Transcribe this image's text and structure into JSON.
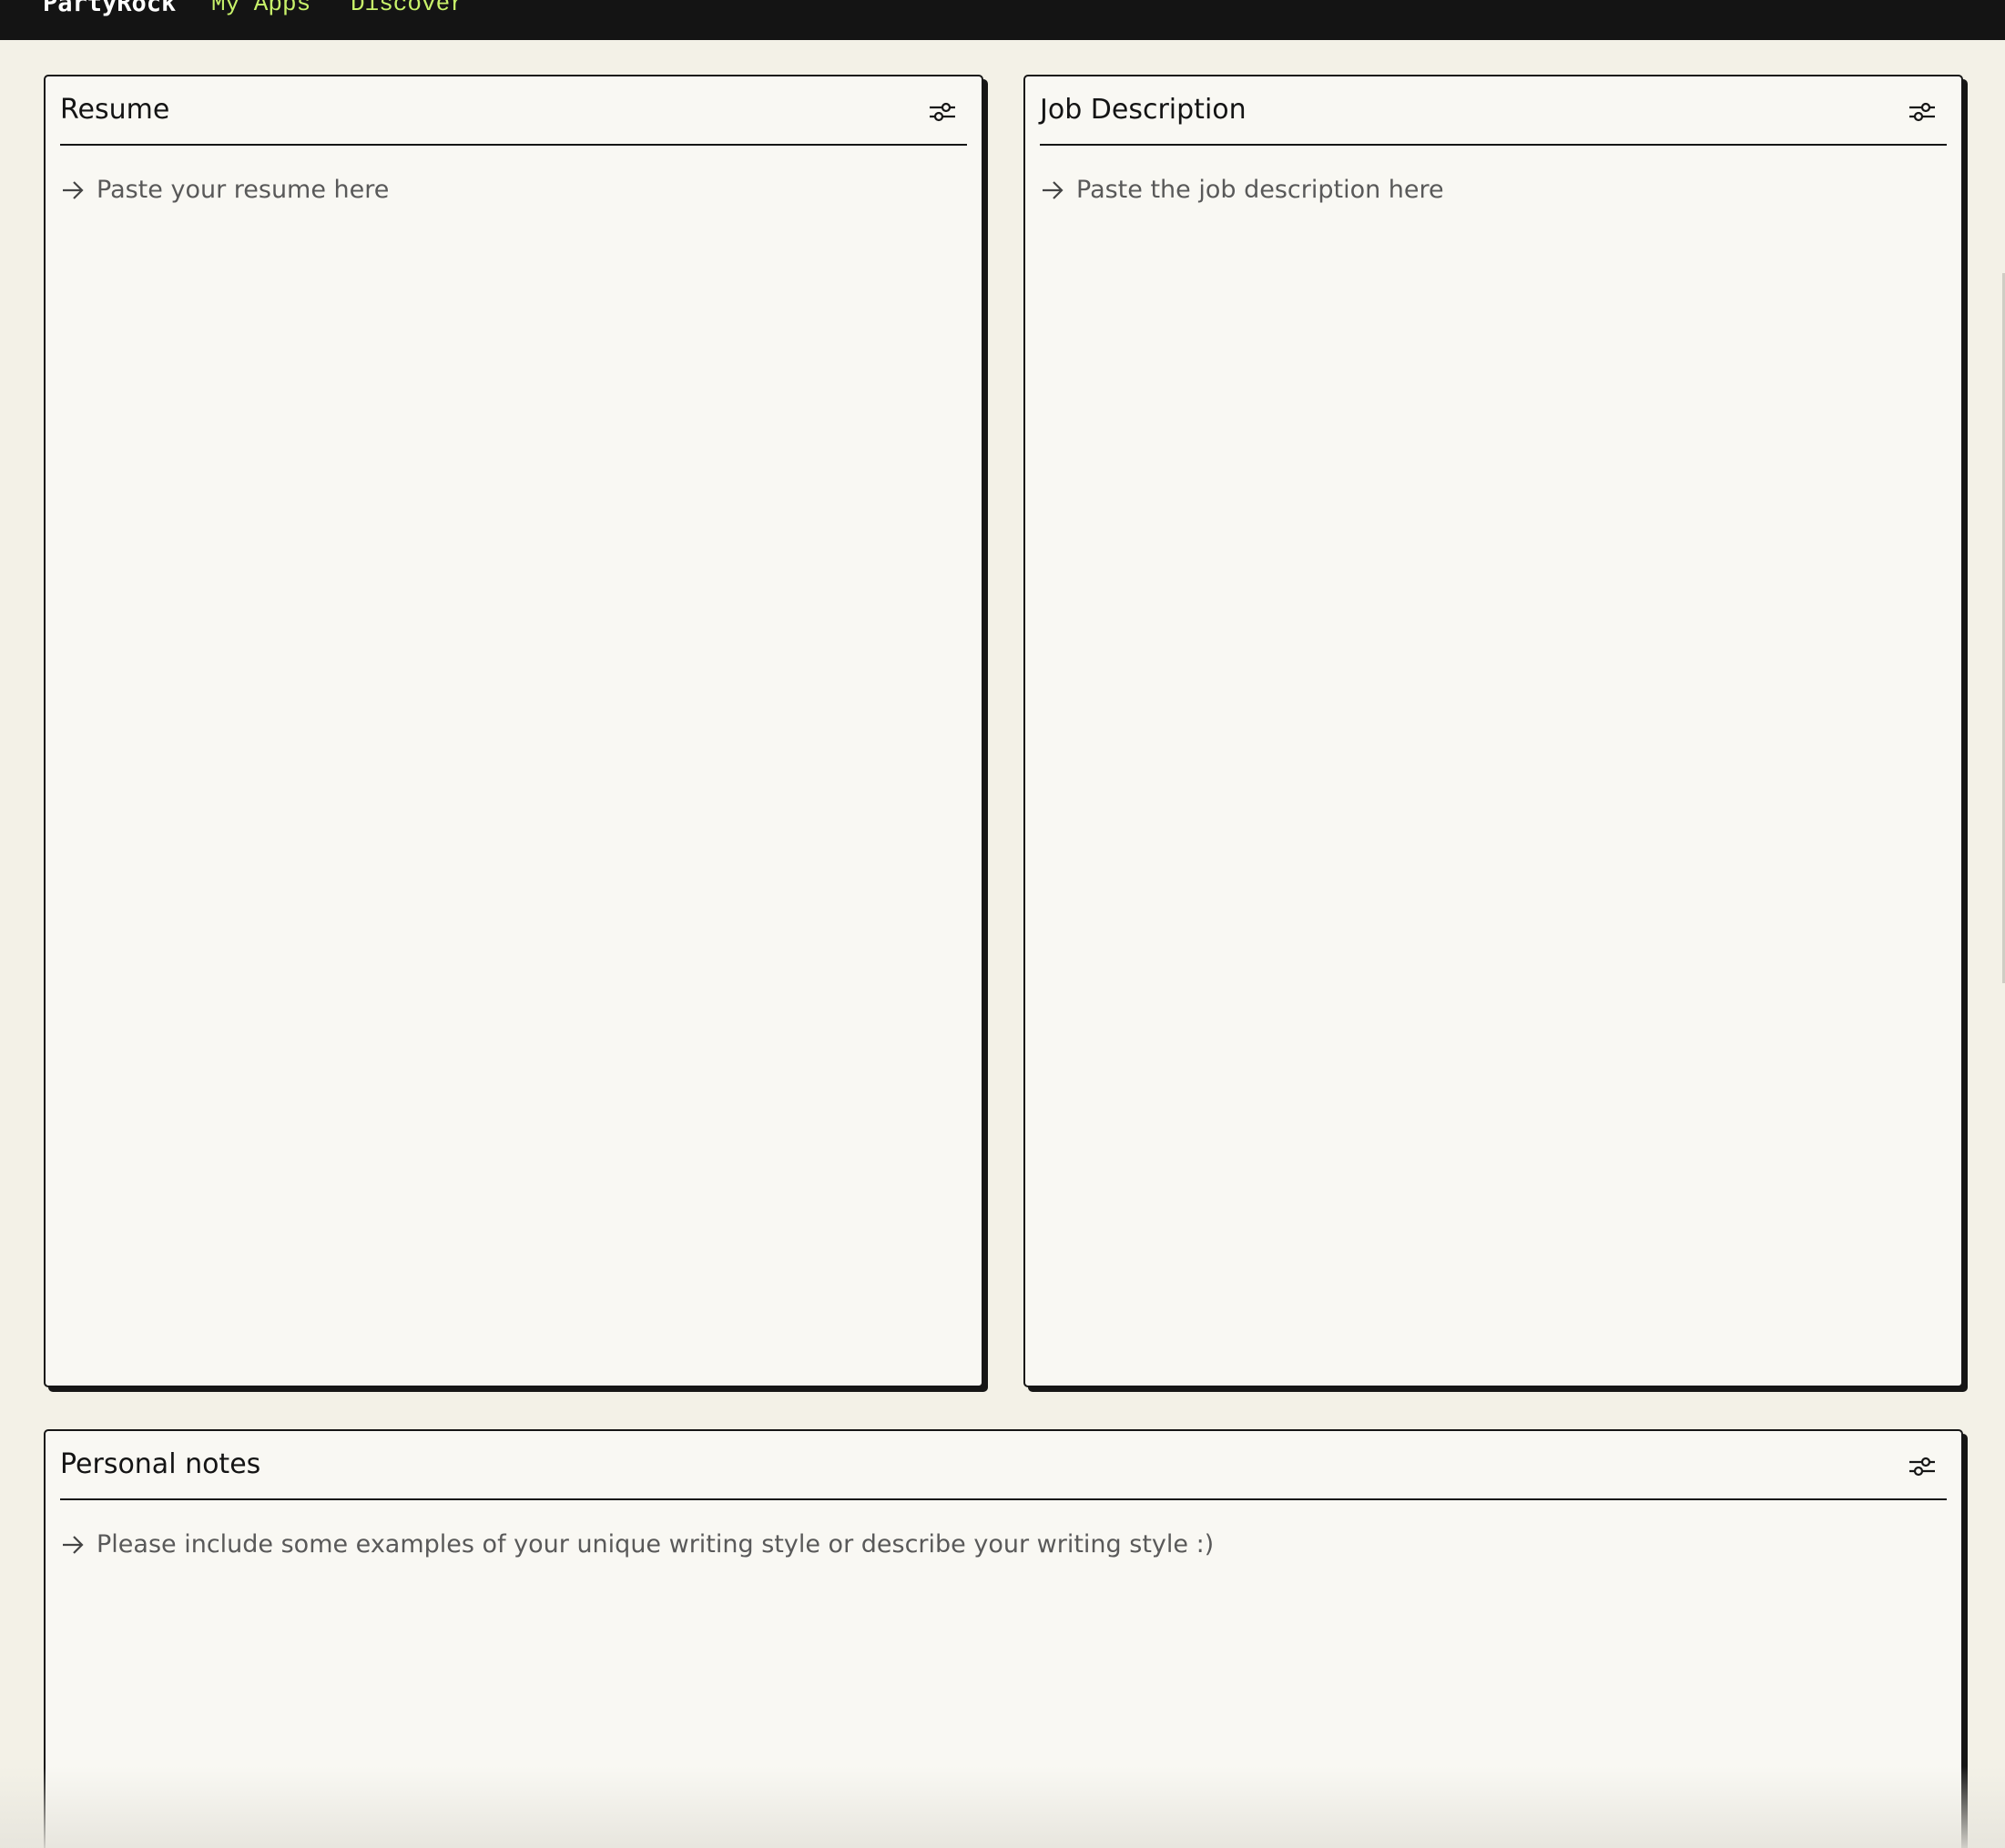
{
  "nav": {
    "brand": "PartyRock",
    "links": [
      {
        "label": "My Apps"
      },
      {
        "label": "Discover"
      }
    ]
  },
  "widgets": [
    {
      "title": "Resume",
      "placeholder": "Paste your resume here",
      "icon": "sliders-icon"
    },
    {
      "title": "Job Description",
      "placeholder": "Paste the job description here",
      "icon": "sliders-icon"
    },
    {
      "title": "Personal notes",
      "placeholder": "Please include some examples of your unique writing style or describe your writing style :)",
      "icon": "sliders-icon"
    }
  ],
  "colors": {
    "background": "#f3f1e7",
    "card": "#f9f8f3",
    "topbar": "#141414",
    "nav_link": "#c8f26a",
    "border": "#161616",
    "placeholder": "#595959"
  }
}
